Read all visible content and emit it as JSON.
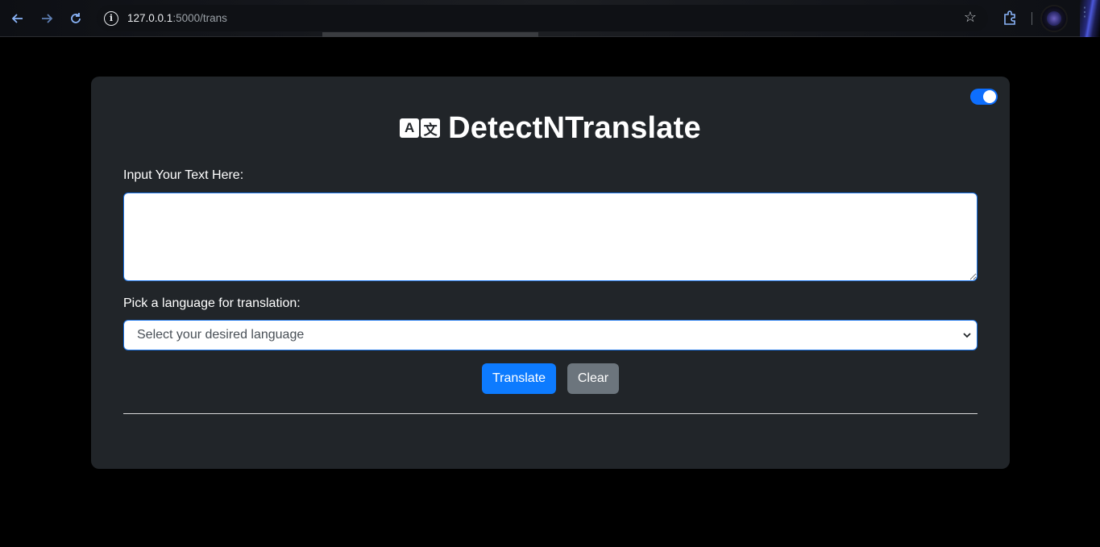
{
  "browser": {
    "url_host": "127.0.0.1",
    "url_path": ":5000/trans",
    "accent_color": "#8ab4f8"
  },
  "app": {
    "title": "DetectNTranslate",
    "icon_glyph_a": "A",
    "icon_glyph_b": "文",
    "dark_mode_toggle": "on"
  },
  "form": {
    "input_label": "Input Your Text Here:",
    "input_value": "",
    "language_label": "Pick a language for translation:",
    "language_selected": "Select your desired language"
  },
  "buttons": {
    "translate_label": "Translate",
    "clear_label": "Clear"
  },
  "colors": {
    "card_bg": "#212529",
    "primary": "#0d7bff",
    "secondary": "#6c757d",
    "toggle_on": "#0d6efd"
  }
}
